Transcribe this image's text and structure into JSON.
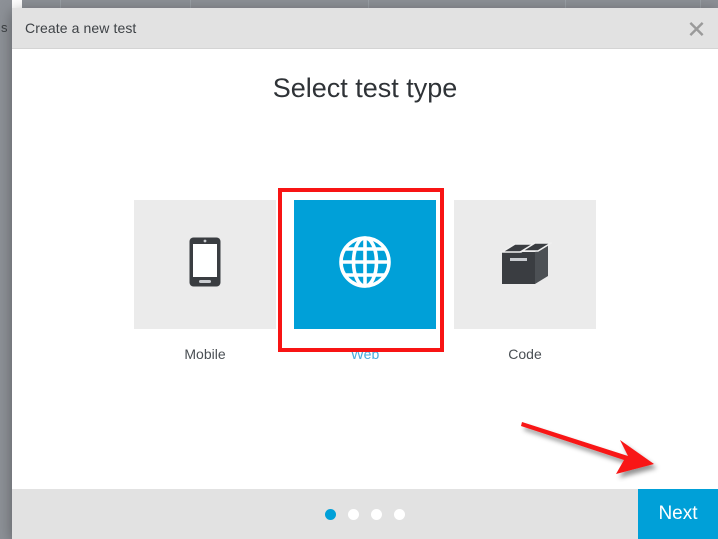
{
  "window": {
    "title": "Create a new test",
    "close_icon": "close-icon"
  },
  "background": {
    "left_text_fragment": "s"
  },
  "main": {
    "heading": "Select test type",
    "options": [
      {
        "label": "Mobile",
        "icon": "smartphone-icon",
        "selected": false
      },
      {
        "label": "Web",
        "icon": "globe-icon",
        "selected": true
      },
      {
        "label": "Code",
        "icon": "package-box-icon",
        "selected": false
      }
    ]
  },
  "footer": {
    "pagination": {
      "total": 4,
      "active_index": 0
    },
    "next_label": "Next"
  },
  "annotations": {
    "selection_box_color": "#f81414",
    "arrow_color": "#f81414",
    "arrow_target": "next-button"
  },
  "colors": {
    "accent_blue": "#00a0d8",
    "tile_gray": "#ebebeb",
    "chrome_gray": "#e2e2e2",
    "text_dark": "#3e4246"
  }
}
